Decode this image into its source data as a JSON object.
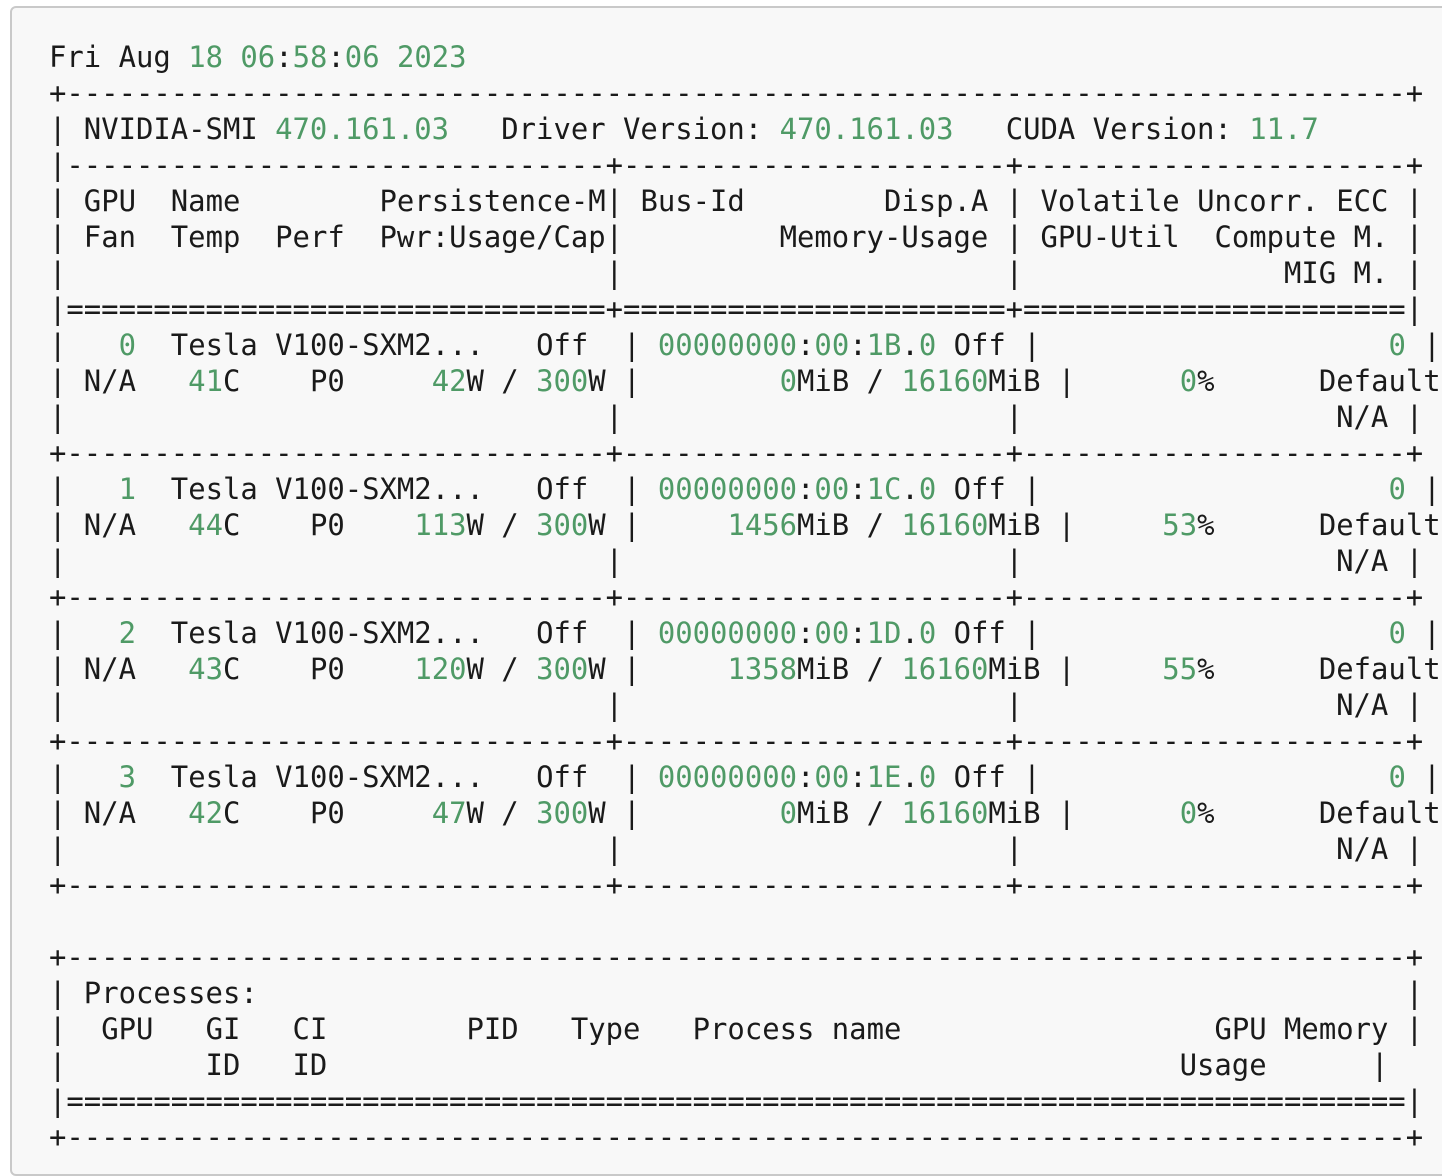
{
  "timestamp": {
    "weekday": "Fri",
    "month": "Aug",
    "day": "18",
    "hour": "06",
    "minute": "58",
    "second": "06",
    "year": "2023"
  },
  "smi": {
    "label": "NVIDIA-SMI",
    "version": "470.161.03",
    "driver_label": "Driver Version:",
    "driver_version": "470.161.03",
    "cuda_label": "CUDA Version:",
    "cuda_version": "11.7"
  },
  "headers": {
    "gpu": "GPU",
    "name": "Name",
    "persistence": "Persistence-M",
    "bus_id": "Bus-Id",
    "disp": "Disp.A",
    "volatile": "Volatile Uncorr. ECC",
    "fan": "Fan",
    "temp": "Temp",
    "perf": "Perf",
    "pwr": "Pwr:Usage/Cap",
    "memory_usage": "Memory-Usage",
    "gpu_util": "GPU-Util",
    "compute_mode": "Compute M.",
    "mig_mode": "MIG M."
  },
  "gpus": [
    {
      "index": "0",
      "name": "Tesla V100-SXM2...",
      "persistence": "Off",
      "bus_prefix": "00000000",
      "bus_mid": "00",
      "bus_dev": "1B",
      "bus_fn": "0",
      "disp": "Off",
      "ecc": "0",
      "fan": "N/A",
      "temp": "41",
      "perf": "P0",
      "pwr_usage": "42",
      "pwr_cap": "300",
      "mem_used": "0",
      "mem_total": "16160",
      "util": "0",
      "compute_mode": "Default",
      "mig_mode": "N/A"
    },
    {
      "index": "1",
      "name": "Tesla V100-SXM2...",
      "persistence": "Off",
      "bus_prefix": "00000000",
      "bus_mid": "00",
      "bus_dev": "1C",
      "bus_fn": "0",
      "disp": "Off",
      "ecc": "0",
      "fan": "N/A",
      "temp": "44",
      "perf": "P0",
      "pwr_usage": "113",
      "pwr_cap": "300",
      "mem_used": "1456",
      "mem_total": "16160",
      "util": "53",
      "compute_mode": "Default",
      "mig_mode": "N/A"
    },
    {
      "index": "2",
      "name": "Tesla V100-SXM2...",
      "persistence": "Off",
      "bus_prefix": "00000000",
      "bus_mid": "00",
      "bus_dev": "1D",
      "bus_fn": "0",
      "disp": "Off",
      "ecc": "0",
      "fan": "N/A",
      "temp": "43",
      "perf": "P0",
      "pwr_usage": "120",
      "pwr_cap": "300",
      "mem_used": "1358",
      "mem_total": "16160",
      "util": "55",
      "compute_mode": "Default",
      "mig_mode": "N/A"
    },
    {
      "index": "3",
      "name": "Tesla V100-SXM2...",
      "persistence": "Off",
      "bus_prefix": "00000000",
      "bus_mid": "00",
      "bus_dev": "1E",
      "bus_fn": "0",
      "disp": "Off",
      "ecc": "0",
      "fan": "N/A",
      "temp": "42",
      "perf": "P0",
      "pwr_usage": "47",
      "pwr_cap": "300",
      "mem_used": "0",
      "mem_total": "16160",
      "util": "0",
      "compute_mode": "Default",
      "mig_mode": "N/A"
    }
  ],
  "processes": {
    "title": "Processes:",
    "col_gpu": "GPU",
    "col_gi": "GI",
    "col_ci": "CI",
    "col_pid": "PID",
    "col_type": "Type",
    "col_name": "Process name",
    "col_mem": "GPU Memory",
    "gi_id": "ID",
    "ci_id": "ID",
    "mem_usage": "Usage"
  },
  "colors": {
    "number_accent": "#4f9a66",
    "text": "#1a1a1a",
    "background": "#f8f8f8"
  }
}
